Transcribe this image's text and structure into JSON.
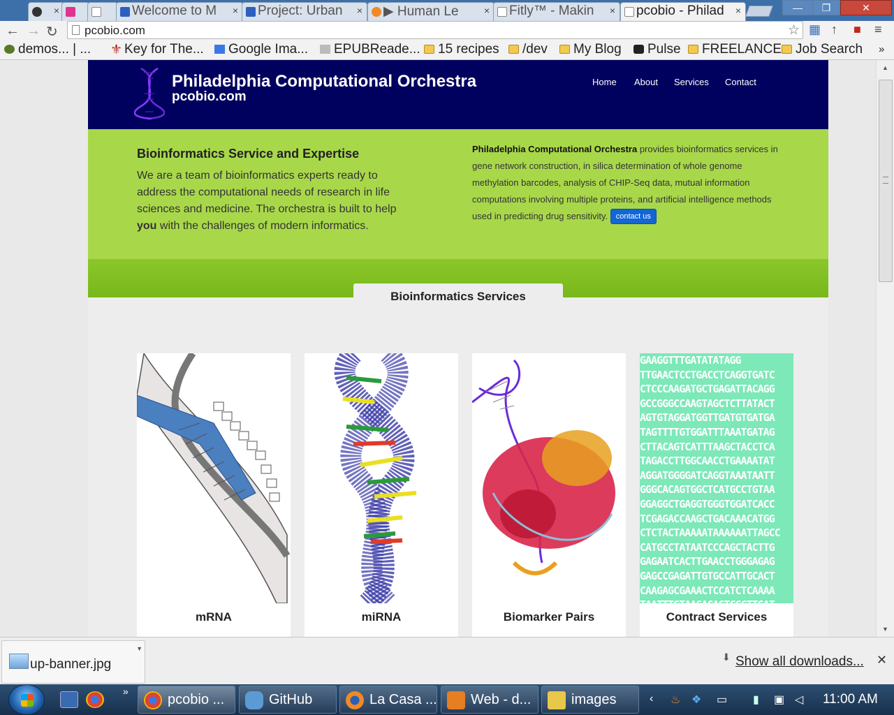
{
  "browser": {
    "tabs": [
      {
        "label": "",
        "icon": "github-icon"
      },
      {
        "label": "",
        "icon": "pink-app-icon"
      },
      {
        "label": "",
        "icon": "page-icon"
      },
      {
        "label": "Welcome to M",
        "icon": "meetup-icon"
      },
      {
        "label": "Project: Urban",
        "icon": "meetup-icon"
      },
      {
        "label": "▶ Human Le",
        "icon": "audio-icon"
      },
      {
        "label": "Fitly™ - Makin",
        "icon": "page-icon"
      },
      {
        "label": "pcobio - Philad",
        "icon": "page-icon"
      }
    ],
    "url": "pcobio.com",
    "bookmarks": [
      "demos... | ...",
      "Key for The...",
      "Google Ima...",
      "EPUBReade...",
      "15 recipes",
      "/dev",
      "My Blog",
      "Pulse",
      "FREELANCE",
      "Job Search"
    ],
    "bookmarks_more": "»"
  },
  "site": {
    "brand_name": "Philadelphia Computational Orchestra",
    "brand_domain": "pcobio.com",
    "menu": [
      "Home",
      "About",
      "Services",
      "Contact"
    ],
    "hero": {
      "heading": "Bioinformatics Service and Expertise",
      "intro_before": "We are a team of bioinformatics experts ready to address the computational needs of research in life sciences and medicine. The orchestra is built to help ",
      "intro_bold": "you",
      "intro_after": " with the challenges of modern informatics.",
      "right_bold": "Philadelphia Computational Orchestra",
      "right_text": " provides bioinformatics services in gene network construction, in silica determination of whole genome methylation barcodes, analysis of CHIP-Seq data, mutual information computations involving multiple proteins, and artificial intelligence methods used in predicting drug sensitivity. ",
      "contact_button": "contact us"
    },
    "services_tab": "Bioinformatics Services",
    "services": [
      "mRNA",
      "miRNA",
      "Biomarker Pairs",
      "Contract Services"
    ],
    "dna_lines": [
      "GAAGGTTTGATATATAGG",
      "TTGAACTCCTGACCTCAGGTGATC",
      "CTCCCAAGATGCTGAGATTACAGG",
      "GCCGGGCCAAGTAGCTCTTATACT",
      "AGTGTAGGATGGTTGATGTGATGA",
      "TAGTTTTGTGGATTTAAATGATAG",
      "CTTACAGTCATTTAAGCTACCTCA",
      "TAGACCTTGGCAACCTGAAAATAT",
      "AGGATGGGGATCAGGTAAATAATT",
      "GGGCACAGTGGCTCATGCCTGTAA",
      "GGAGGCTGAGGTGGGTGGATCACC",
      "TCGAGACCAAGCTGACAAACATGG",
      "CTCTACTAAAAATAAAAAATTAGCC",
      "CATGCCTATAATCCCAGCTACTTG",
      "GAGAATCACTTGAACCTGGGAGAG",
      "GAGCCGAGATTGTGCCATTGCACT",
      "CAAGAGCGAAACTCCATCTCAAAA",
      "TAATTTGTAAGACAGTCCCTTGAT"
    ]
  },
  "downloads": {
    "file": "up-banner.jpg",
    "show_all": "Show all downloads..."
  },
  "taskbar": {
    "items": [
      "pcobio ...",
      "GitHub",
      "La Casa ...",
      "Web - d...",
      "images"
    ],
    "clock": "11:00 AM",
    "overflow": "»"
  },
  "colors": {
    "header_navy": "#00005e",
    "hero_green": "#a8d84a",
    "button_blue": "#1266d6"
  }
}
